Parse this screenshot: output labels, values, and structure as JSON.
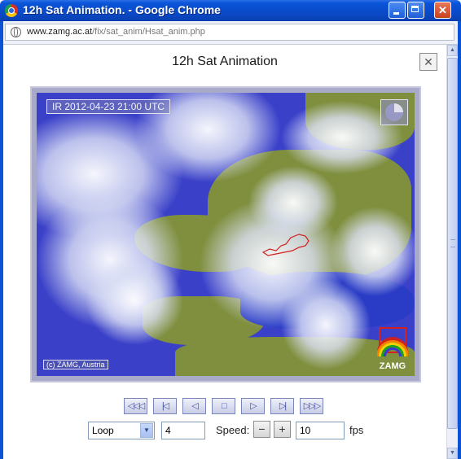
{
  "window": {
    "title": "12h Sat Animation. - Google Chrome",
    "close_glyph": "✕"
  },
  "address_bar": {
    "domain": "www.zamg.ac.at",
    "path": "/fix/sat_anim/Hsat_anim.php"
  },
  "page": {
    "title": "12h Sat Animation",
    "close_glyph": "✕"
  },
  "map": {
    "timestamp": "IR 2012-04-23 21:00 UTC",
    "copyright": "(c) ZAMG, Austria",
    "logo_text": "ZAMG"
  },
  "controls": {
    "first_glyph": "◁◁◁",
    "prev_glyph": "|◁",
    "back_glyph": "◁",
    "stop_glyph": "□",
    "play_glyph": "▷",
    "next_glyph": "▷|",
    "last_glyph": "▷▷▷",
    "mode_value": "Loop",
    "frames_value": "4",
    "speed_label": "Speed:",
    "speed_minus": "−",
    "speed_plus": "+",
    "speed_value": "10",
    "fps_label": "fps"
  },
  "colors": {
    "titlebar": "#0a54d8",
    "sea": "#2a3cc6",
    "land": "#7f8f3e",
    "austria_outline": "#d32020"
  }
}
